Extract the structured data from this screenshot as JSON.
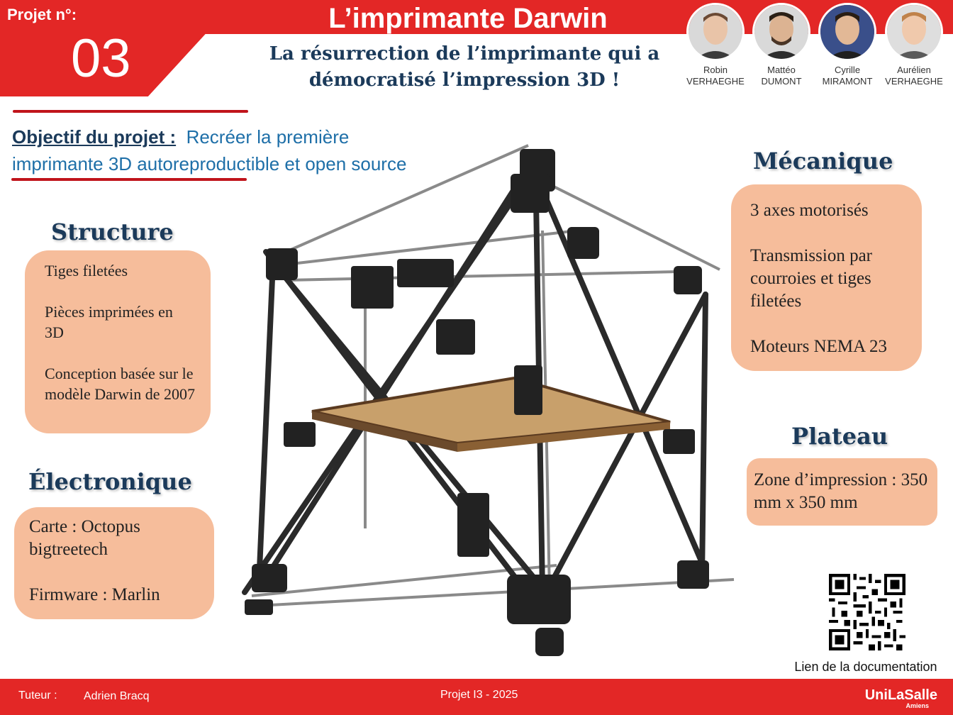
{
  "header": {
    "project_label": "Projet n°:",
    "project_number": "03",
    "title": "L’imprimante Darwin",
    "subtitle_line1": "La résurrection de l’imprimante qui a",
    "subtitle_line2": "démocratisé l’impression 3D !"
  },
  "team": [
    {
      "first": "Robin",
      "last": "VERHAEGHE"
    },
    {
      "first": "Mattéo",
      "last": "DUMONT"
    },
    {
      "first": "Cyrille",
      "last": "MIRAMONT"
    },
    {
      "first": "Aurélien",
      "last": "VERHAEGHE"
    }
  ],
  "objective": {
    "label": "Objectif du projet :",
    "text_line1": "Recréer la première",
    "text_line2": "imprimante 3D autoreproductible et open source"
  },
  "structure": {
    "title": "Structure",
    "items": [
      "Tiges filetées",
      "Pièces imprimées en 3D",
      "Conception basée sur le modèle Darwin de 2007"
    ]
  },
  "electronique": {
    "title": "Électronique",
    "items": [
      "Carte : Octopus bigtreetech",
      "Firmware : Marlin"
    ]
  },
  "mecanique": {
    "title": "Mécanique",
    "items": [
      "3 axes motorisés",
      "Transmission par courroies et tiges filetées",
      "Moteurs NEMA 23"
    ]
  },
  "plateau": {
    "title": "Plateau",
    "items": [
      "Zone d’impression : 350 mm x 350 mm"
    ]
  },
  "qr": {
    "caption": "Lien de la documentation"
  },
  "footer": {
    "tutor_label": "Tuteur :",
    "tutor_name": "Adrien Bracq",
    "project": "Projet I3 - 2025",
    "logo": "UniLaSalle",
    "logo_sub": "Amiens"
  },
  "colors": {
    "brand_red": "#e32726",
    "navy": "#1b3a5a",
    "box_peach": "#f6bd9b",
    "link_blue": "#1e6fa8"
  }
}
